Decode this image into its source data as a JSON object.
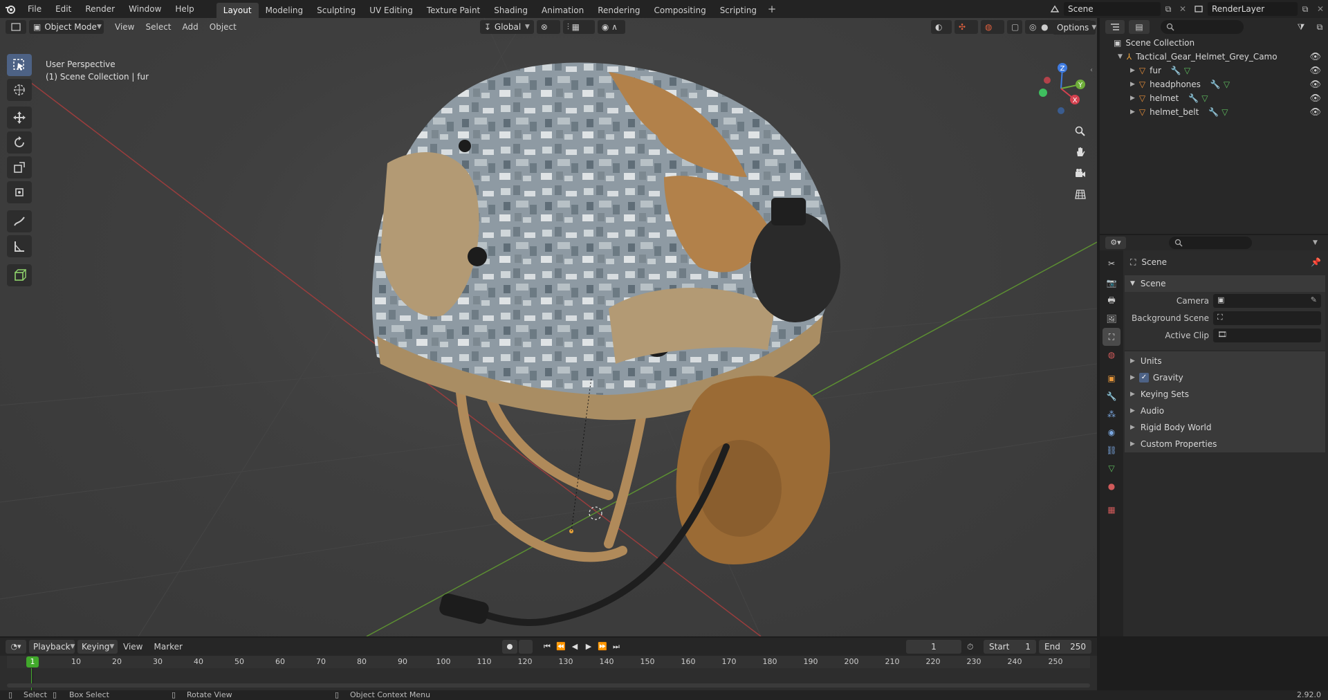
{
  "topbar": {
    "menus": [
      "File",
      "Edit",
      "Render",
      "Window",
      "Help"
    ],
    "workspaces": [
      "Layout",
      "Modeling",
      "Sculpting",
      "UV Editing",
      "Texture Paint",
      "Shading",
      "Animation",
      "Rendering",
      "Compositing",
      "Scripting"
    ],
    "active_workspace": "Layout",
    "plus": "+",
    "scene_name": "Scene",
    "view_layer": "RenderLayer"
  },
  "viewport": {
    "mode": "Object Mode",
    "menus": [
      "View",
      "Select",
      "Add",
      "Object"
    ],
    "orientation": "Global",
    "options_label": "Options",
    "overlay_title": "User Perspective",
    "overlay_subtitle": "(1) Scene Collection | fur",
    "gizmo_axes": [
      "Z",
      "Y",
      "X"
    ]
  },
  "outliner": {
    "root": "Scene Collection",
    "collection": "Tactical_Gear_Helmet_Grey_Camo",
    "objects": [
      "fur",
      "headphones",
      "helmet",
      "helmet_belt"
    ]
  },
  "properties": {
    "header": "Scene",
    "panel": "Scene",
    "fields": [
      {
        "label": "Camera",
        "value": ""
      },
      {
        "label": "Background Scene",
        "value": ""
      },
      {
        "label": "Active Clip",
        "value": ""
      }
    ],
    "subpanels": [
      "Units",
      "Gravity",
      "Keying Sets",
      "Audio",
      "Rigid Body World",
      "Custom Properties"
    ],
    "gravity_checked": true
  },
  "timeline": {
    "menus": [
      "Playback",
      "Keying",
      "View",
      "Marker"
    ],
    "current_frame": "1",
    "start_label": "Start",
    "start": "1",
    "end_label": "End",
    "end": "250",
    "ruler": [
      "1",
      "10",
      "20",
      "30",
      "40",
      "50",
      "60",
      "70",
      "80",
      "90",
      "100",
      "110",
      "120",
      "130",
      "140",
      "150",
      "160",
      "170",
      "180",
      "190",
      "200",
      "210",
      "220",
      "230",
      "240",
      "250"
    ]
  },
  "statusbar": {
    "select": "Select",
    "box_select": "Box Select",
    "rotate_view": "Rotate View",
    "context_menu": "Object Context Menu",
    "version": "2.92.0"
  },
  "colors": {
    "accent": "#4d6285",
    "header_bg": "#232323",
    "viewport_bg": "#3f3f3f",
    "playhead": "#41a92b",
    "object_orange": "#e88f3a"
  }
}
